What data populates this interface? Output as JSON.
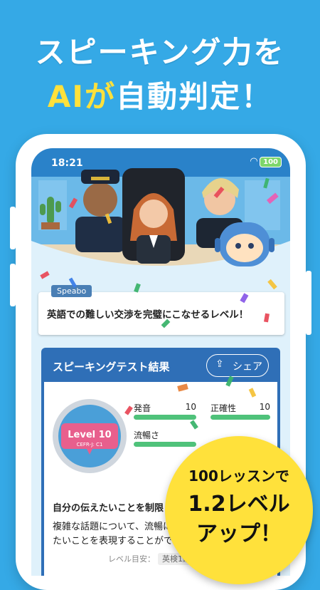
{
  "headline": {
    "line1": "スピーキング力を",
    "line2_highlight": "AIが",
    "line2_rest": "自動判定！"
  },
  "status_bar": {
    "time": "18:21",
    "battery": "100"
  },
  "speech": {
    "speaker": "Speabo",
    "text": "英語での難しい交渉を完璧にこなせるレベル！"
  },
  "result": {
    "title": "スピーキングテスト結果",
    "share_label": "シェア",
    "level_label": "Level 10",
    "cefr_label": "CEFR-J: C1",
    "metrics": [
      {
        "label": "発音",
        "value": "10",
        "fill": 1.0
      },
      {
        "label": "正確性",
        "value": "10",
        "fill": 1.0
      },
      {
        "label": "流暢さ",
        "value": "",
        "fill": 1.0
      }
    ],
    "description_title": "自分の伝えたいことを制限",
    "description_1": "複雑な話題について、流暢に",
    "description_2": "たいことを表現することがで",
    "goal_label": "レベル目安：",
    "goal_chip": "英検1級"
  },
  "badge": {
    "line1": "100レッスンで",
    "line2": "1.2レベル",
    "line3": "アップ！"
  },
  "colors": {
    "background": "#35a9e6",
    "highlight": "#ffe13b",
    "panel": "#2f6fb7",
    "bar": "#4fc27a"
  }
}
